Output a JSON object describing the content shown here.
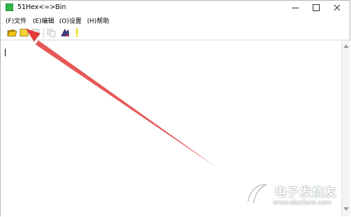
{
  "window": {
    "title": "51Hex<=>Bin",
    "icon": "app-icon"
  },
  "menu": {
    "items": [
      {
        "label": "(F)文件"
      },
      {
        "label": "(E)编辑"
      },
      {
        "label": "(O)设置"
      },
      {
        "label": "(H)帮助"
      }
    ]
  },
  "toolbar": {
    "buttons": [
      {
        "icon": "open-folder-icon"
      },
      {
        "icon": "new-file-icon"
      },
      {
        "icon": "save-icon"
      },
      {
        "icon": "copy-icon"
      },
      {
        "icon": "convert-icon"
      },
      {
        "icon": "help-icon"
      }
    ]
  },
  "editor": {
    "content": ""
  },
  "watermark": {
    "brand": "电子发烧友",
    "url": "www.elecfans.com"
  },
  "colors": {
    "arrow": "#e23a3a",
    "app_icon": "#33b44a"
  }
}
